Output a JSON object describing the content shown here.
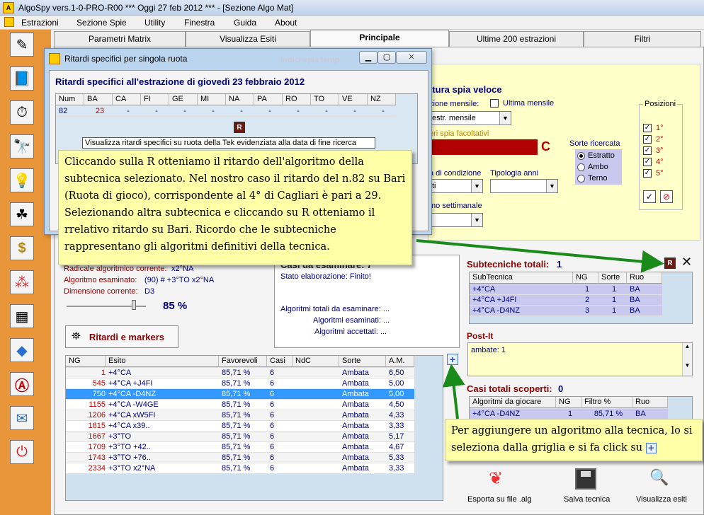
{
  "window": {
    "title": "AlgoSpy vers.1-0-PRO-R00  ***  Oggi 27 feb 2012  ***  - [Sezione Algo Mat]"
  },
  "menu": [
    "Estrazioni",
    "Sezione Spie",
    "Utility",
    "Finestra",
    "Guida",
    "About"
  ],
  "toolbar_icons": [
    "pencil-icon",
    "book-icon",
    "clock-icon",
    "binoculars-icon",
    "lightbulb-icon",
    "clover-icon",
    "dollar-icon",
    "pyramid-icon",
    "calendar-icon",
    "drop-icon",
    "a-icon",
    "mail-icon",
    "power-icon"
  ],
  "tabs": [
    "Parametri Matrix",
    "Visualizza Esiti",
    "Principale",
    "Ultime 200 estrazioni",
    "Filtri"
  ],
  "ghost_tab": "Indici spia temp",
  "popup": {
    "title": "Ritardi specifici per singola ruota",
    "heading": "Ritardi specifici all'estrazione di giovedì 23 febbraio 2012",
    "columns": [
      "Num",
      "BA",
      "CA",
      "FI",
      "GE",
      "MI",
      "NA",
      "PA",
      "RO",
      "TO",
      "VE",
      "NZ"
    ],
    "row": [
      "82",
      "23",
      "-",
      "-",
      "-",
      "-",
      "-",
      "-",
      "-",
      "-",
      "-",
      "-"
    ],
    "tooltip": "Visualizza ritardi specifici su ruota della Tek evidenziata alla data di fine ricerca",
    "r_label": "R"
  },
  "right_panel": {
    "title": "ttura spia veloce",
    "mensile_label": "zione mensile:",
    "ultima_mensile": "Ultima mensile",
    "combo_mensile": "estr. mensile",
    "facoltativi": "eri spia facoltativi",
    "c_letter": "C",
    "condizione": "a di condizione",
    "condizione_val": "ti",
    "tipologia": "Tipologia anni",
    "settimanale": "mo settimanale",
    "sorte_title": "Sorte ricercata",
    "sorte_options": [
      "Estratto",
      "Ambo",
      "Terno"
    ],
    "posizioni_title": "Posizioni",
    "posizioni": [
      "1°",
      "2°",
      "3°",
      "4°",
      "5°"
    ]
  },
  "left_info": {
    "radicale_label": "Radicale algoritmico corrente:",
    "radicale_val": "x2°NA",
    "esaminato_label": "Algoritmo esaminato:",
    "esaminato_val": "(90) # +3°TO x2°NA",
    "dimensione_label": "Dimensione corrente:",
    "dimensione_val": "D3",
    "percent": "85 %",
    "ritardi_btn": "Ritardi e markers"
  },
  "casi": {
    "title": "Casi da esaminare: 7",
    "stato": "Stato elaborazione: Finito!",
    "totali": "Algoritmi totali da esaminare:   ...",
    "esaminati": "Algoritmi esaminati:   ...",
    "accettati": "Algoritmi accettati:   ..."
  },
  "results": {
    "columns": [
      "NG",
      "Esito",
      "Favorevoli",
      "Casi",
      "NdC scoperti",
      "Sorte",
      "A.M."
    ],
    "rows": [
      [
        "1",
        "+4°CA",
        "85,71 %",
        "6",
        "",
        "Ambata",
        "6,50"
      ],
      [
        "545",
        "+4°CA +J4FI",
        "85,71 %",
        "6",
        "",
        "Ambata",
        "5,00"
      ],
      [
        "750",
        "+4°CA -D4NZ",
        "85,71 %",
        "6",
        "",
        "Ambata",
        "5,00"
      ],
      [
        "1155",
        "+4°CA -W4GE",
        "85,71 %",
        "6",
        "",
        "Ambata",
        "4,50"
      ],
      [
        "1206",
        "+4°CA xW5FI",
        "85,71 %",
        "6",
        "",
        "Ambata",
        "4,33"
      ],
      [
        "1615",
        "+4°CA x39..",
        "85,71 %",
        "6",
        "",
        "Ambata",
        "3,33"
      ],
      [
        "1667",
        "+3°TO",
        "85,71 %",
        "6",
        "",
        "Ambata",
        "5,17"
      ],
      [
        "1709",
        "+3°TO +42..",
        "85,71 %",
        "6",
        "",
        "Ambata",
        "4,67"
      ],
      [
        "1743",
        "+3°TO +76..",
        "85,71 %",
        "6",
        "",
        "Ambata",
        "5,33"
      ],
      [
        "2334",
        "+3°TO x2°NA",
        "85,71 %",
        "6",
        "",
        "Ambata",
        "3,33"
      ]
    ],
    "selected_index": 2
  },
  "subtecniche": {
    "title": "Subtecniche totali:",
    "count": "1",
    "columns": [
      "SubTecnica",
      "NG",
      "Sorte",
      "Ruo"
    ],
    "rows": [
      [
        "+4°CA",
        "1",
        "1",
        "BA"
      ],
      [
        "+4°CA +J4FI",
        "2",
        "1",
        "BA"
      ],
      [
        "+4°CA -D4NZ",
        "3",
        "1",
        "BA"
      ]
    ]
  },
  "postit": {
    "title": "Post-It",
    "text": "ambate: 1"
  },
  "casi_totali": {
    "title": "Casi totali scoperti:",
    "count": "0",
    "columns": [
      "Algoritmi da giocare",
      "NG",
      "Filtro %",
      "Ruo"
    ],
    "rows": [
      [
        "+4°CA -D4NZ",
        "1",
        "85,71 %",
        "BA"
      ]
    ]
  },
  "bottom_buttons": [
    "Esporta su file .alg",
    "Salva tecnica",
    "Visualizza esiti"
  ],
  "notes": {
    "note1": "Cliccando sulla R otteniamo il ritardo dell'algoritmo della subtecnica selezionato. Nel nostro caso il ritardo del n.82 su Bari (Ruota di gioco), corrispondente al 4° di Cagliari è pari a 29. Selezionando altra subtecnica e cliccando su R otteniamo il rrelativo ritardo su Bari. Ricordo che le subtecniche rappresentano gli algoritmi definitivi della tecnica.",
    "note2": "Per aggiungere un algoritmo alla tecnica, lo si seleziona dalla griglia e si fa click su"
  },
  "colors": {
    "accent_red": "#8b0000",
    "toolbar_orange": "#e9953a",
    "note_yellow": "#ffffa8",
    "arrow_green": "#1a8a1a"
  }
}
